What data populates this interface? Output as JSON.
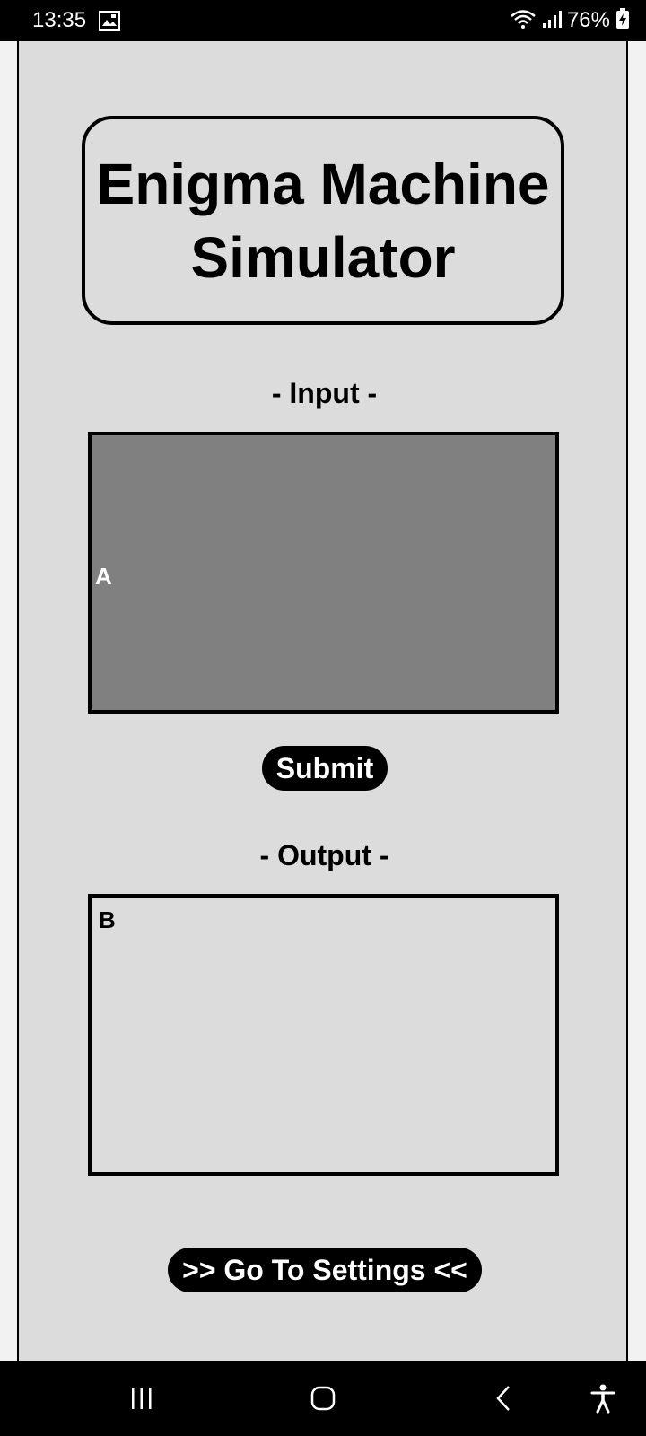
{
  "status_bar": {
    "time": "13:35",
    "battery_percent": "76%",
    "icons": [
      "gallery-notification-icon",
      "wifi-icon",
      "signal-icon",
      "battery-charging-icon"
    ]
  },
  "app": {
    "title": "Enigma Machine Simulator",
    "input_label": "- Input -",
    "input_value": "A",
    "submit_label": "Submit",
    "output_label": "- Output -",
    "output_value": "B",
    "settings_label": ">> Go To Settings <<"
  },
  "nav_bar": {
    "icons": [
      "recent-apps-icon",
      "home-icon",
      "back-icon",
      "accessibility-icon"
    ]
  },
  "colors": {
    "panel_background": "#dcdcdc",
    "input_background": "#808080",
    "button_background": "#000000",
    "button_text": "#ffffff"
  }
}
